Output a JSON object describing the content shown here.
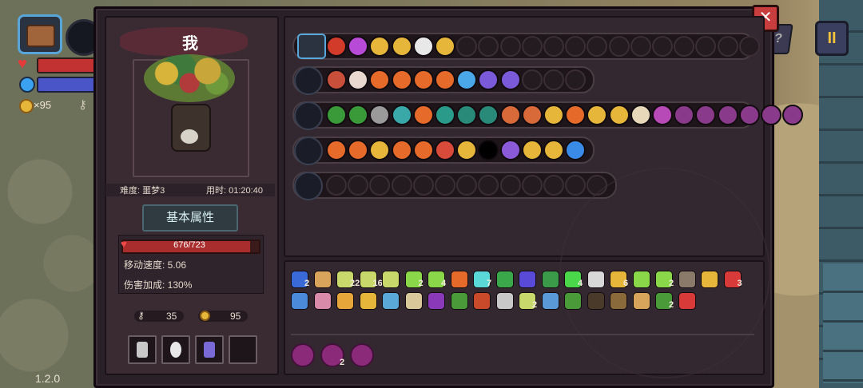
{
  "hud": {
    "coins": "×95",
    "version": "1.2.0",
    "help_label": "?",
    "pause_label": "II"
  },
  "close_label": "✕",
  "character": {
    "name": "我",
    "difficulty": "难度: 噩梦3",
    "time_used": "用时: 01:20:40",
    "attr_button": "基本属性",
    "hp": "676/723",
    "hp_fraction": 0.935,
    "move_speed": "移动速度: 5.06",
    "damage_bonus": "伤害加成: 130%",
    "keys": "35",
    "coins": "95"
  },
  "colors": {
    "panel": "#2a2028",
    "accent_red": "#c83d3d",
    "hp_red": "#a92d2d",
    "mana_blue": "#4a56c8",
    "gold": "#e6b63a"
  },
  "equipment_rows": [
    {
      "name": "bag",
      "filled": [
        "#d23a2a",
        "#b84ad8",
        "#e6b63a",
        "#e6b63a",
        "#e8e8e8",
        "#e6b63a"
      ],
      "empty": 14
    },
    {
      "name": "weapon-1",
      "filled": [
        "#c8503a",
        "#e8d8d0",
        "#e66a2a",
        "#e66a2a",
        "#e66a2a",
        "#e66a2a",
        "#4aa8e8",
        "#7a5ad8",
        "#7a5ad8"
      ],
      "empty": 3
    },
    {
      "name": "weapon-2",
      "filled": [
        "#3a9a3a",
        "#3a9a3a",
        "#9a9a9a",
        "#3aa8a8",
        "#e66a2a",
        "#2a9a8a",
        "#2a8a7a",
        "#2a8a7a",
        "#d86a3a",
        "#d86a3a",
        "#e6b63a",
        "#e66a2a",
        "#e6b63a",
        "#e6b63a",
        "#e6d8b8",
        "#b84ab8",
        "#8a3a8a",
        "#8a3a8a",
        "#8a3a8a",
        "#8a3a8a",
        "#8a3a8a",
        "#8a3a8a"
      ],
      "empty": 0
    },
    {
      "name": "weapon-3",
      "filled": [
        "#e66a2a",
        "#e66a2a",
        "#e6b63a",
        "#e66a2a",
        "#e66a2a",
        "#d84a3a",
        "#e6b63a",
        "#000000",
        "#8a5ad8",
        "#e6b63a",
        "#e6b63a",
        "#3a8ae8"
      ],
      "empty": 0
    },
    {
      "name": "weapon-4",
      "filled": [],
      "empty": 13
    }
  ],
  "inventory": {
    "row1": [
      {
        "icon": "blue-helmet-icon",
        "color": "#3a6ad8",
        "count": "2"
      },
      {
        "icon": "hand-icon",
        "color": "#d8a35a",
        "count": ""
      },
      {
        "icon": "feather-icon",
        "color": "#c8d86a",
        "count": "22"
      },
      {
        "icon": "arrows-icon",
        "color": "#c8d86a",
        "count": "16"
      },
      {
        "icon": "wing-icon",
        "color": "#c8d86a",
        "count": ""
      },
      {
        "icon": "green-feather-icon",
        "color": "#8ad84a",
        "count": "2"
      },
      {
        "icon": "bow-icon",
        "color": "#8ad84a",
        "count": "4"
      },
      {
        "icon": "heart-icon",
        "color": "#e66a2a",
        "count": ""
      },
      {
        "icon": "crossbow-icon",
        "color": "#5ad8d8",
        "count": "7"
      },
      {
        "icon": "scroll-icon",
        "color": "#3aa84a",
        "count": ""
      },
      {
        "icon": "book-icon",
        "color": "#5a4ad8",
        "count": ""
      },
      {
        "icon": "boot-icon",
        "color": "#3a9a4a",
        "count": ""
      },
      {
        "icon": "clover-icon",
        "color": "#4ad84a",
        "count": "4"
      },
      {
        "icon": "box-icon",
        "color": "#d8d8d8",
        "count": ""
      },
      {
        "icon": "claw-icon",
        "color": "#e6b63a",
        "count": "6"
      },
      {
        "icon": "sword-icon",
        "color": "#8ad84a",
        "count": ""
      },
      {
        "icon": "dagger-icon",
        "color": "#8ad84a",
        "count": "2"
      },
      {
        "icon": "armor-icon",
        "color": "#8a7a6a",
        "count": ""
      },
      {
        "icon": "magnifier-icon",
        "color": "#e6b63a",
        "count": ""
      },
      {
        "icon": "potion-icon",
        "color": "#d83a3a",
        "count": "3"
      }
    ],
    "row2": [
      {
        "icon": "star-icon",
        "color": "#4a8ad8",
        "count": ""
      },
      {
        "icon": "brain-icon",
        "color": "#d88aa8",
        "count": ""
      },
      {
        "icon": "scroll-red-icon",
        "color": "#e6a63a",
        "count": ""
      },
      {
        "icon": "leaf-icon",
        "color": "#e6b63a",
        "count": ""
      },
      {
        "icon": "crystal-icon",
        "color": "#5aa8d8",
        "count": ""
      },
      {
        "icon": "cloud-icon",
        "color": "#d8c89a",
        "count": ""
      },
      {
        "icon": "witch-hat-icon",
        "color": "#8a3ab8",
        "count": ""
      },
      {
        "icon": "frog-icon",
        "color": "#4a9a3a",
        "count": ""
      },
      {
        "icon": "map-icon",
        "color": "#c84a2a",
        "count": ""
      },
      {
        "icon": "chain-icon",
        "color": "#c8c8c8",
        "count": ""
      },
      {
        "icon": "wing2-icon",
        "color": "#c8d86a",
        "count": "2"
      },
      {
        "icon": "shield-icon",
        "color": "#5a9ad8",
        "count": ""
      },
      {
        "icon": "sprout-icon",
        "color": "#4a9a3a",
        "count": ""
      },
      {
        "icon": "mask-icon",
        "color": "#4a3a2a",
        "count": ""
      },
      {
        "icon": "lantern-icon",
        "color": "#8a6a3a",
        "count": ""
      },
      {
        "icon": "coin-icon",
        "color": "#d8a35a",
        "count": ""
      },
      {
        "icon": "vine-icon",
        "color": "#4a9a3a",
        "count": "2"
      },
      {
        "icon": "fire-icon",
        "color": "#d83a3a",
        "count": ""
      }
    ],
    "rings": [
      {
        "icon": "ring-1-icon",
        "count": ""
      },
      {
        "icon": "ring-2-icon",
        "count": "2"
      },
      {
        "icon": "ring-3-icon",
        "count": ""
      }
    ]
  }
}
